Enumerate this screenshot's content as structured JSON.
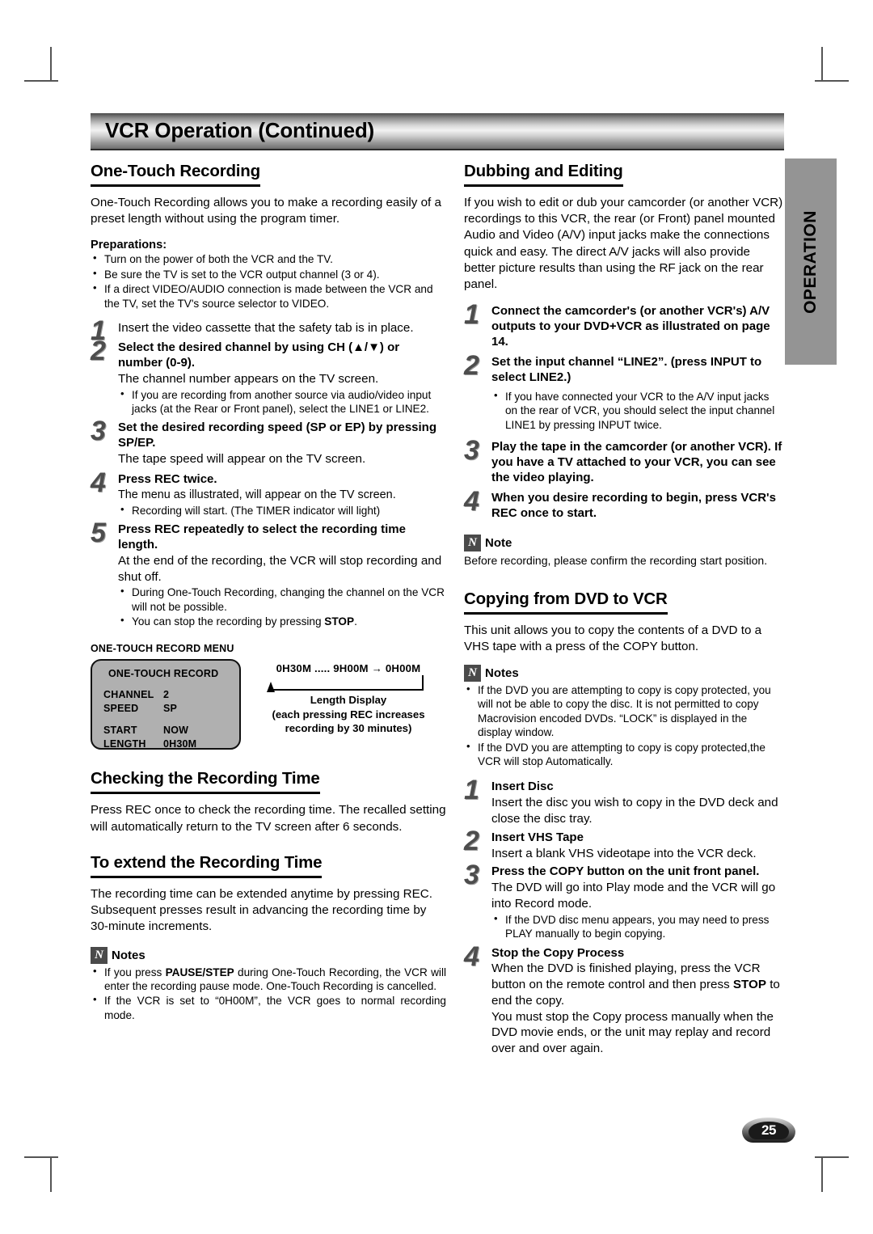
{
  "header": {
    "title": "VCR Operation (Continued)"
  },
  "side_tab": {
    "label": "OPERATION"
  },
  "page_badge": {
    "number": "25"
  },
  "left_column": {
    "section1": {
      "heading": "One-Touch Recording",
      "intro": "One-Touch Recording allows you to make a recording easily of a preset length without using the program timer.",
      "preparations_label": "Preparations:",
      "preparations": [
        "Turn on the power of both the VCR and the TV.",
        "Be sure the TV is set to the VCR output channel (3 or 4).",
        "If a direct VIDEO/AUDIO connection is made between the VCR and the TV, set the TV's source selector to VIDEO."
      ],
      "steps": [
        {
          "num": "1",
          "title": "Insert the video cassette that the safety tab is in place.",
          "bold": false,
          "body": "",
          "bullets": []
        },
        {
          "num": "2",
          "title": "Select the desired channel by using CH (▲/▼) or number (0-9).",
          "bold": true,
          "body": "The channel number appears on the TV screen.",
          "bullets": [
            "If you are recording from another source via audio/video input jacks (at the Rear or Front panel), select the LINE1 or LINE2."
          ]
        },
        {
          "num": "3",
          "title": "Set the desired recording speed (SP or EP) by pressing SP/EP.",
          "bold": true,
          "body": "The tape speed will appear on the TV screen.",
          "bullets": []
        },
        {
          "num": "4",
          "title": "Press REC twice.",
          "bold": true,
          "body": "The menu as illustrated, will appear on the TV screen.",
          "bullets": [
            "Recording will start. (The TIMER indicator will light)"
          ]
        },
        {
          "num": "5",
          "title": "Press REC repeatedly to select the recording time length.",
          "bold": true,
          "body": "At the end of the recording, the VCR will stop recording and shut off.",
          "bullets": [
            "During One-Touch Recording, changing the channel on the VCR will not be possible.",
            "You can stop the recording by pressing STOP."
          ]
        }
      ]
    },
    "figure": {
      "title": "ONE-TOUCH RECORD MENU",
      "osd_title": "ONE-TOUCH RECORD",
      "rows": [
        {
          "key": "CHANNEL",
          "value": "2"
        },
        {
          "key": "SPEED",
          "value": "SP"
        },
        {
          "key": "START",
          "value": "NOW"
        },
        {
          "key": "LENGTH",
          "value": "0H30M"
        }
      ],
      "length_display": {
        "sequence": "0H30M  .....  9H00M → 0H00M",
        "caption_line1": "Length Display",
        "caption_line2": "(each pressing REC increases",
        "caption_line3": "recording by 30 minutes)"
      }
    },
    "section2": {
      "heading": "Checking the Recording Time",
      "body": "Press REC once to check the recording time. The recalled setting will automatically return to the TV screen after 6 seconds."
    },
    "section3": {
      "heading": "To extend the Recording Time",
      "body1": "The recording time can be extended anytime by pressing REC.",
      "body2": "Subsequent presses result in advancing the recording time by 30-minute increments."
    },
    "notes": {
      "icon": "note-icon",
      "label": "Notes",
      "items": [
        "If you press PAUSE/STEP during One-Touch Recording, the VCR will enter the recording pause mode. One-Touch Recording is cancelled.",
        "If the VCR is set to “0H00M”, the VCR goes to normal recording mode."
      ]
    }
  },
  "right_column": {
    "section1": {
      "heading": "Dubbing and Editing",
      "intro": "If you wish to edit or dub your camcorder (or another VCR) recordings to this VCR, the rear (or Front) panel mounted Audio and Video (A/V) input jacks make the connections quick and easy. The direct A/V jacks will also provide better picture results than using the RF jack on the rear panel.",
      "steps": [
        {
          "num": "1",
          "title": "Connect the camcorder's (or another VCR's) A/V outputs to your DVD+VCR as illustrated on page 14.",
          "body": "",
          "bullets": []
        },
        {
          "num": "2",
          "title": "Set the input channel “LINE2”. (press INPUT to select LINE2.)",
          "body": "",
          "bullets": [
            "If you have connected your VCR to the A/V input jacks on the rear of VCR, you should select the input channel LINE1 by pressing INPUT twice."
          ]
        },
        {
          "num": "3",
          "title": "Play the tape in the camcorder (or another VCR). If you have a TV attached to your VCR, you can see the video playing.",
          "body": "",
          "bullets": []
        },
        {
          "num": "4",
          "title": "When you desire recording to begin, press VCR's REC once to start.",
          "body": "",
          "bullets": []
        }
      ],
      "note": {
        "label": "Note",
        "text": "Before recording, please confirm the recording start position."
      }
    },
    "section2": {
      "heading": "Copying from DVD to VCR",
      "intro": "This unit allows you to copy the contents of a DVD to a VHS tape with a press of the COPY button.",
      "notes": {
        "label": "Notes",
        "items": [
          "If the DVD you are attempting to copy is copy protected, you will not be able to copy the disc. It is not permitted to copy Macrovision encoded DVDs. “LOCK” is displayed in the display window.",
          "If the DVD you are attempting to copy is copy protected,the VCR will stop Automatically."
        ]
      },
      "steps": [
        {
          "num": "1",
          "title": "Insert Disc",
          "body": "Insert the disc you wish to copy in the DVD deck and close the disc tray.",
          "bullets": []
        },
        {
          "num": "2",
          "title": "Insert VHS Tape",
          "body": "Insert a blank VHS videotape into the VCR deck.",
          "bullets": []
        },
        {
          "num": "3",
          "title": "Press the COPY button on the unit front panel.",
          "body": "The DVD will go into Play mode and the VCR will go into Record mode.",
          "bullets": [
            "If the DVD disc menu appears, you may need to press PLAY manually to begin copying."
          ]
        },
        {
          "num": "4",
          "title": "Stop the Copy Process",
          "body": "When the DVD is finished playing, press the VCR button on the remote control and then press STOP to end the copy.",
          "body2": "You must stop the Copy process manually when the DVD movie ends, or the unit may replay and record over and over again.",
          "bullets": []
        }
      ]
    }
  }
}
